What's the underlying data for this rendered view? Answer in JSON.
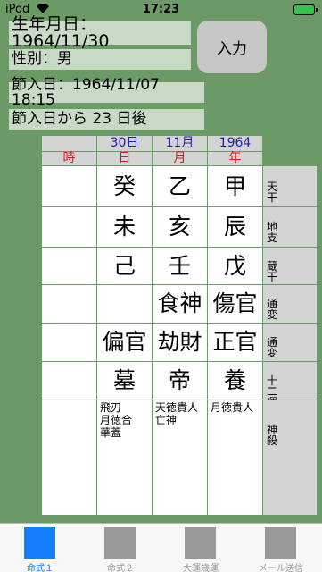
{
  "status_bar": {
    "carrier": "iPod",
    "time": "17:23"
  },
  "info": {
    "birth": "生年月日：1964/11/30",
    "sex": "性別：男",
    "setsu": "節入日：1964/11/07 18:15",
    "days": "節入日から 23 日後"
  },
  "input_button": "入力",
  "table": {
    "date_headers": [
      "30日",
      "11月",
      "1964"
    ],
    "pillar_headers": [
      "時",
      "日",
      "月",
      "年"
    ],
    "row_labels": [
      "天干",
      "地支",
      "蔵干",
      "通変",
      "通変",
      "十二運",
      "神殺"
    ],
    "rows": [
      [
        "",
        "癸",
        "乙",
        "甲"
      ],
      [
        "",
        "未",
        "亥",
        "辰"
      ],
      [
        "",
        "己",
        "壬",
        "戊"
      ],
      [
        "",
        "",
        "食神",
        "傷官"
      ],
      [
        "",
        "偏官",
        "劫財",
        "正官"
      ],
      [
        "",
        "墓",
        "帝",
        "養"
      ]
    ],
    "shinsatsu": [
      "",
      "飛刃\n月徳合\n華蓋",
      "天徳貴人\n亡神",
      "月徳貴人"
    ]
  },
  "tabs": [
    {
      "label": "命式１",
      "active": true
    },
    {
      "label": "命式２",
      "active": false
    },
    {
      "label": "大運歳運",
      "active": false
    },
    {
      "label": "メール送信",
      "active": false
    }
  ],
  "colors": {
    "background": "#6b9a66",
    "accent": "#147efb",
    "header_blue": "#2020a0",
    "header_red": "#cc2020"
  }
}
